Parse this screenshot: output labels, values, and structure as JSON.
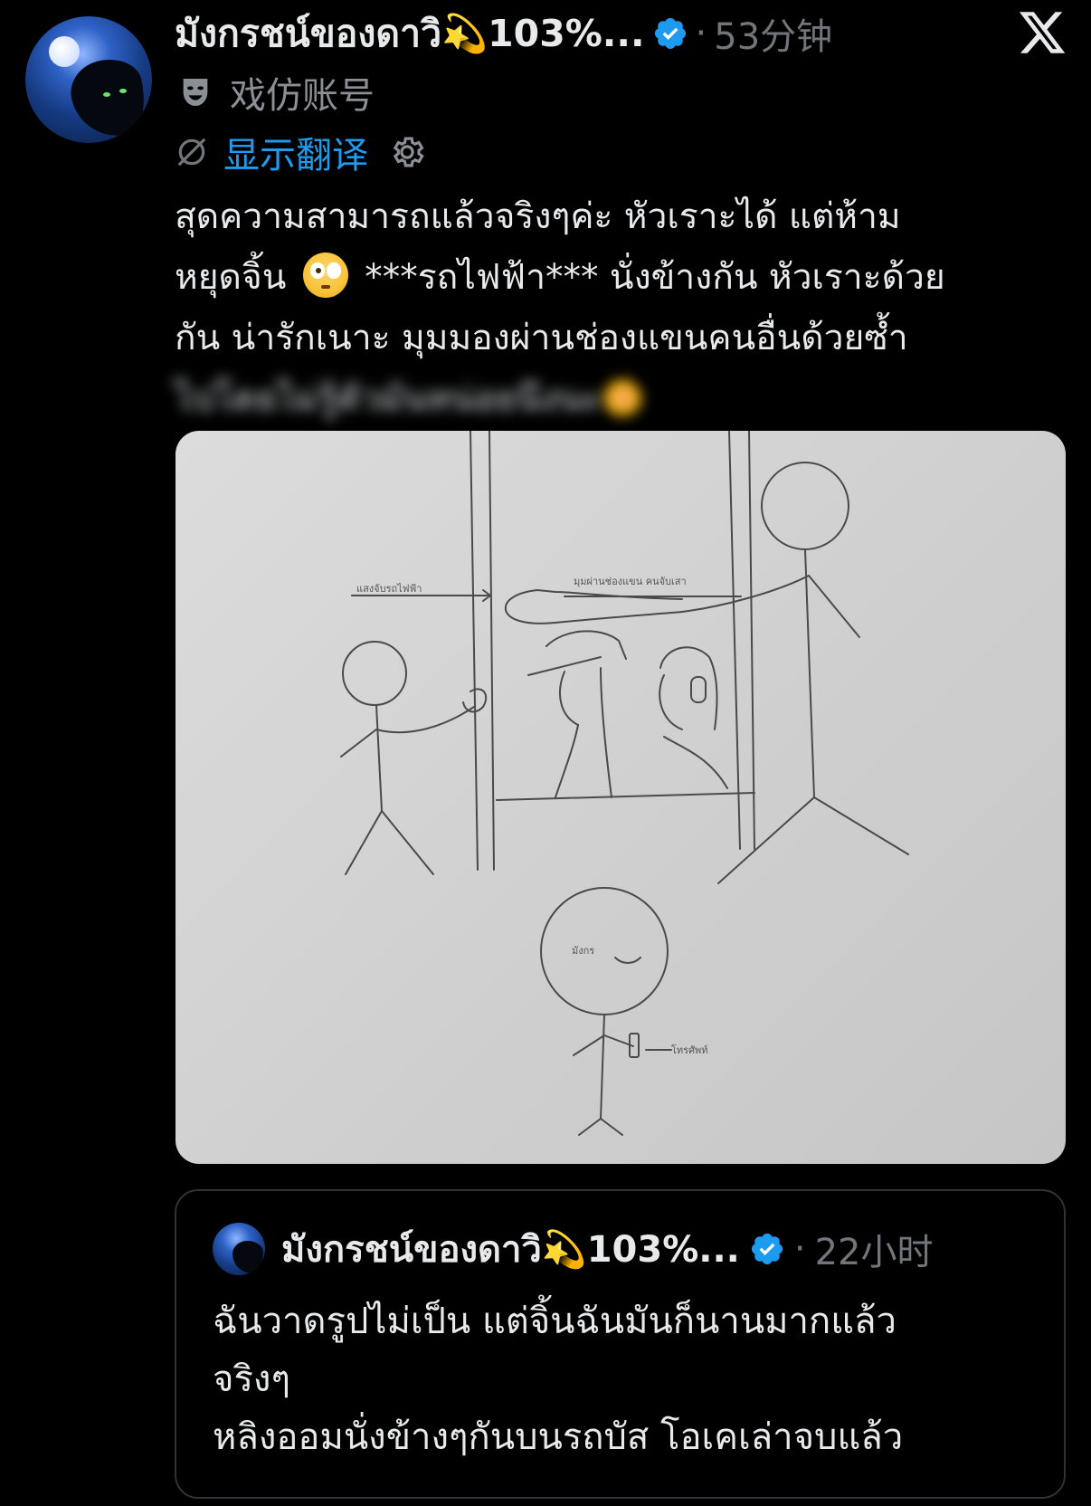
{
  "post": {
    "author_name": "มังกรชน์ของดาวิ💫103%...",
    "separator": "·",
    "time": "53分钟",
    "parody_label": "戏仿账号",
    "translate_label": "显示翻译",
    "text_lines": [
      "สุดความสามารถแล้วจริงๆค่ะ หัวเราะได้ แต่ห้าม",
      "หยุดจิ้น",
      "***รถไฟฟ้า*** นั่งข้างกัน หัวเราะด้วย",
      "กัน น่ารักเนาะ มุมมองผ่านช่องแขนคนอื่นด้วยซ้ำ"
    ],
    "icons": {
      "verified": "verified-badge-icon",
      "close": "x-logo-icon",
      "parody": "parody-mask-icon",
      "translate": "no-translate-icon",
      "settings": "gear-icon",
      "emoji": "flushed-face-emoji"
    },
    "colors": {
      "background": "#000000",
      "text": "#e7e9ea",
      "muted": "#71767b",
      "link": "#1d9bf0",
      "verified": "#1d9bf0",
      "border": "#2f3336"
    }
  },
  "media": {
    "sketch_labels": {
      "left_arrow": "แสงจับรถไฟฟ้า",
      "top_arrow": "มุมผ่านช่องแขน คนจับเสา",
      "face": "มังกร",
      "phone": "โทรศัพท์"
    }
  },
  "quote": {
    "author_name": "มังกรชน์ของดาวิ💫103%...",
    "separator": "·",
    "time": "22小时",
    "text_lines": [
      "ฉันวาดรูปไม่เป็น แต่จิ้นฉันมันก็นานมากแล้ว",
      "จริงๆ",
      "หลิงออมนั่งข้างๆกันบนรถบัส โอเคเล่าจบแล้ว"
    ]
  }
}
